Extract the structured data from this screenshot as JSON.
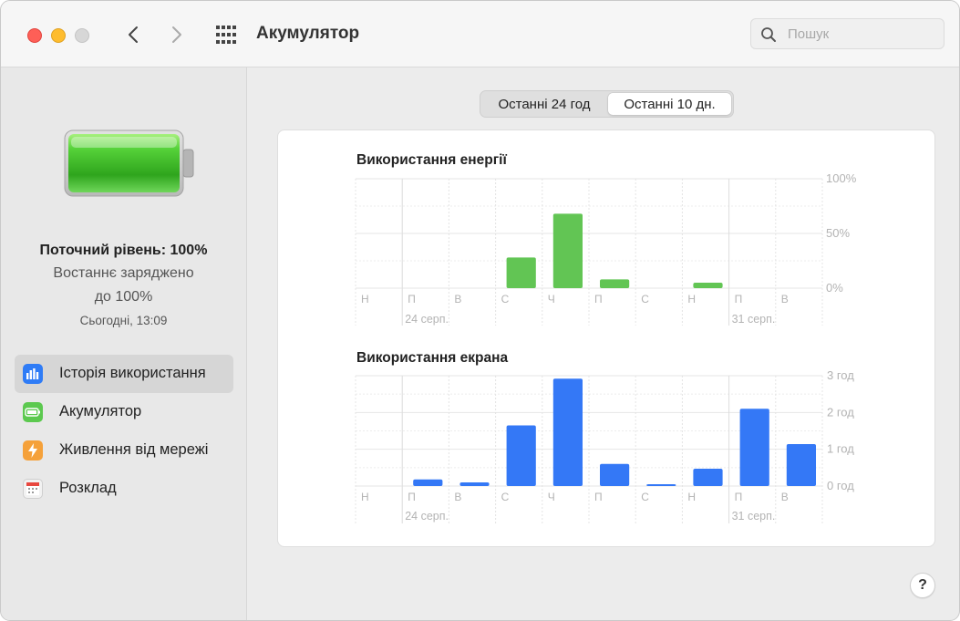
{
  "window": {
    "title": "Акумулятор"
  },
  "search": {
    "placeholder": "Пошук"
  },
  "sidebar": {
    "level_main": "Поточний рівень: 100%",
    "level_sub1": "Востаннє заряджено",
    "level_sub2": "до 100%",
    "level_time": "Сьогодні, 13:09",
    "items": [
      {
        "label": "Історія використання",
        "icon": "usage-history-icon",
        "selected": true
      },
      {
        "label": "Акумулятор",
        "icon": "battery-icon",
        "selected": false
      },
      {
        "label": "Живлення від мережі",
        "icon": "power-adapter-icon",
        "selected": false
      },
      {
        "label": "Розклад",
        "icon": "calendar-icon",
        "selected": false
      }
    ]
  },
  "segmented": {
    "option_24h": "Останні 24 год",
    "option_10d": "Останні 10 дн.",
    "selected": "option_10d"
  },
  "help": {
    "label": "?"
  },
  "chart_data": [
    {
      "type": "bar",
      "title": "Використання енергії",
      "categories": [
        "Н",
        "П",
        "В",
        "С",
        "Ч",
        "П",
        "С",
        "Н",
        "П",
        "В"
      ],
      "date_labels": [
        {
          "index": 1,
          "text": "24 серп."
        },
        {
          "index": 8,
          "text": "31 серп."
        }
      ],
      "values": [
        0,
        0,
        0,
        28,
        68,
        8,
        0,
        5,
        0,
        0
      ],
      "y_ticks": [
        "100%",
        "50%",
        "0%"
      ],
      "ylim": [
        0,
        100
      ],
      "color": "#62c554",
      "grid": true
    },
    {
      "type": "bar",
      "title": "Використання екрана",
      "categories": [
        "Н",
        "П",
        "В",
        "С",
        "Ч",
        "П",
        "С",
        "Н",
        "П",
        "В"
      ],
      "date_labels": [
        {
          "index": 1,
          "text": "24 серп."
        },
        {
          "index": 8,
          "text": "31 серп."
        }
      ],
      "values": [
        0,
        0.18,
        0.1,
        1.65,
        2.92,
        0.6,
        0.03,
        0.47,
        2.1,
        1.14
      ],
      "y_ticks": [
        "3 год",
        "2 год",
        "1 год",
        "0 год"
      ],
      "ylim": [
        0,
        3
      ],
      "color": "#3478f6",
      "grid": true
    }
  ]
}
